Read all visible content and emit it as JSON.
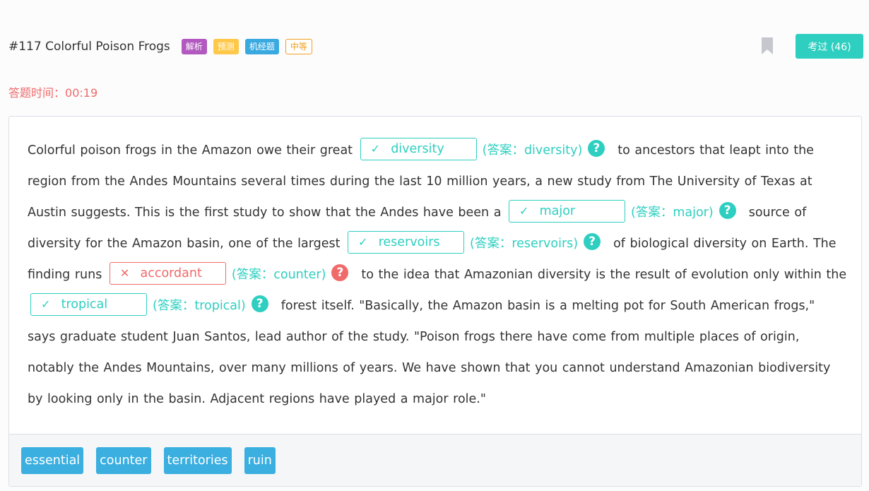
{
  "header": {
    "title": "#117 Colorful Poison Frogs",
    "tags": [
      "解析",
      "预测",
      "机经题",
      "中等"
    ],
    "passed_button": "考过 (46)"
  },
  "timer": {
    "label": "答题时间：",
    "value": "00:19"
  },
  "passage": {
    "segments": [
      "Colorful poison frogs in the Amazon owe their great",
      "to ancestors that leapt into the region from the Andes Mountains several times during the last 10 million years, a new study from The University of Texas at Austin suggests. This is the first study to show that the Andes have been a",
      "source of diversity for the Amazon basin, one of the largest",
      "of biological diversity on Earth. The finding runs",
      "to the idea that Amazonian diversity is the result of evolution only within the",
      "forest itself. \"Basically, the Amazon basin is a melting pot for South American frogs,\" says graduate student Juan Santos, lead author of the study. \"Poison frogs there have come from multiple places of origin, notably the Andes Mountains, over many millions of years. We have shown that you cannot understand Amazonian biodiversity by looking only in the basin. Adjacent regions have played a major role.\""
    ],
    "blanks": [
      {
        "status": "correct",
        "mark": "✓",
        "filled": "diversity",
        "answer": "(答案：diversity)"
      },
      {
        "status": "correct",
        "mark": "✓",
        "filled": "major",
        "answer": "(答案：major)"
      },
      {
        "status": "correct",
        "mark": "✓",
        "filled": "reservoirs",
        "answer": "(答案：reservoirs)"
      },
      {
        "status": "wrong",
        "mark": "✕",
        "filled": "accordant",
        "answer": "(答案：counter)"
      },
      {
        "status": "correct",
        "mark": "✓",
        "filled": "tropical",
        "answer": "(答案：tropical)"
      }
    ],
    "help_glyph": "?"
  },
  "word_bank": [
    "essential",
    "counter",
    "territories",
    "ruin"
  ],
  "colors": {
    "accent": "#2ecfc0",
    "error": "#f06a6a",
    "word": "#3aafe0"
  },
  "icons": {
    "bookmark": "bookmark-icon",
    "correct": "check-icon",
    "wrong": "cross-icon",
    "help": "question-circle-icon"
  }
}
